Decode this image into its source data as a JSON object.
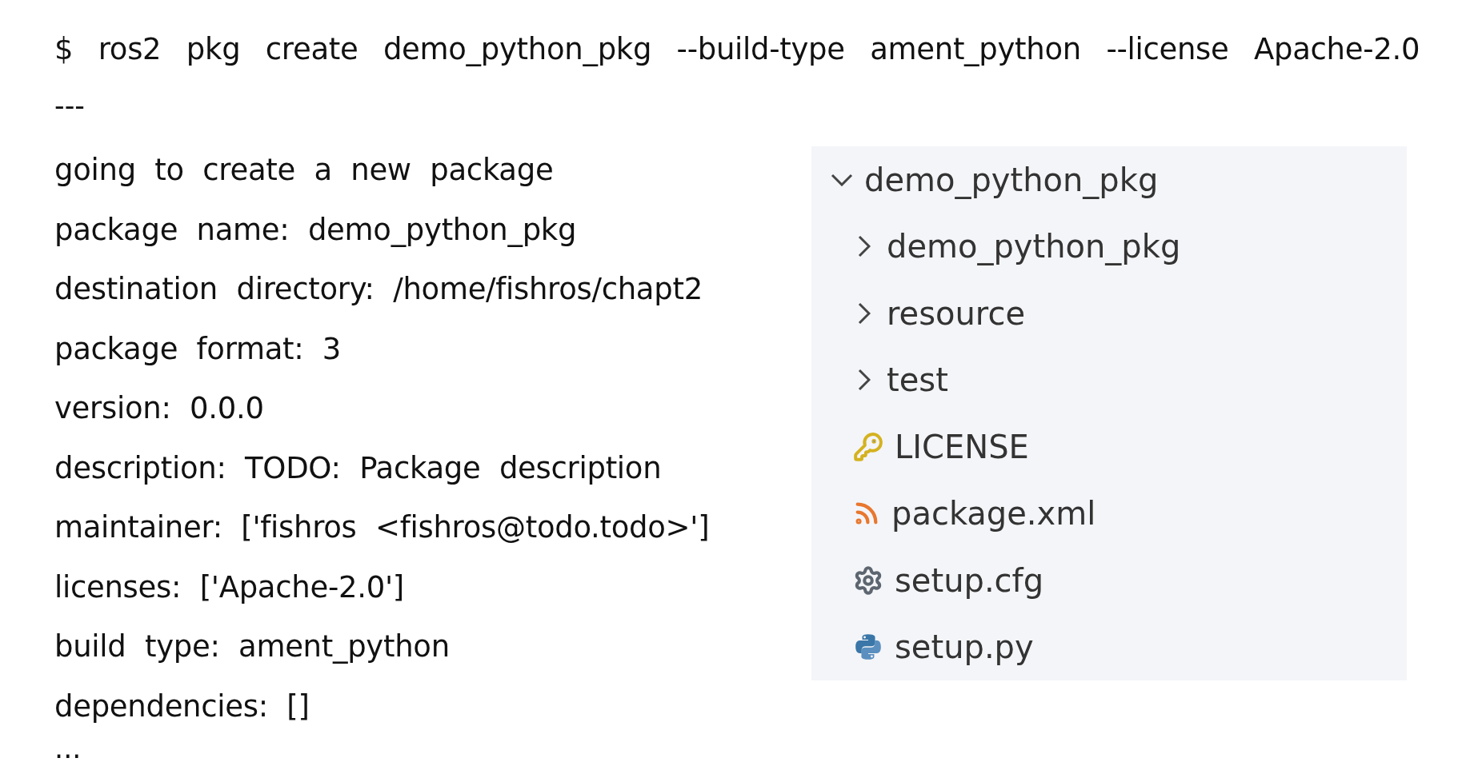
{
  "terminal": {
    "command": "$ ros2 pkg create demo_python_pkg --build-type ament_python --license Apache-2.0",
    "separator": "---",
    "lines": [
      "going to create a new package",
      "package name: demo_python_pkg",
      "destination directory: /home/fishros/chapt2",
      "package format: 3",
      "version: 0.0.0",
      "description: TODO: Package description",
      "maintainer: ['fishros <fishros@todo.todo>']",
      "licenses: ['Apache-2.0']",
      "build type: ament_python",
      "dependencies: []"
    ],
    "ellipsis": "..."
  },
  "file_tree": {
    "label": "demo_python_pkg",
    "expanded": true,
    "children": [
      {
        "kind": "folder",
        "label": "demo_python_pkg",
        "expanded": false
      },
      {
        "kind": "folder",
        "label": "resource",
        "expanded": false
      },
      {
        "kind": "folder",
        "label": "test",
        "expanded": false
      },
      {
        "kind": "license",
        "label": "LICENSE"
      },
      {
        "kind": "xml",
        "label": "package.xml"
      },
      {
        "kind": "config",
        "label": "setup.cfg"
      },
      {
        "kind": "python",
        "label": "setup.py"
      }
    ]
  }
}
